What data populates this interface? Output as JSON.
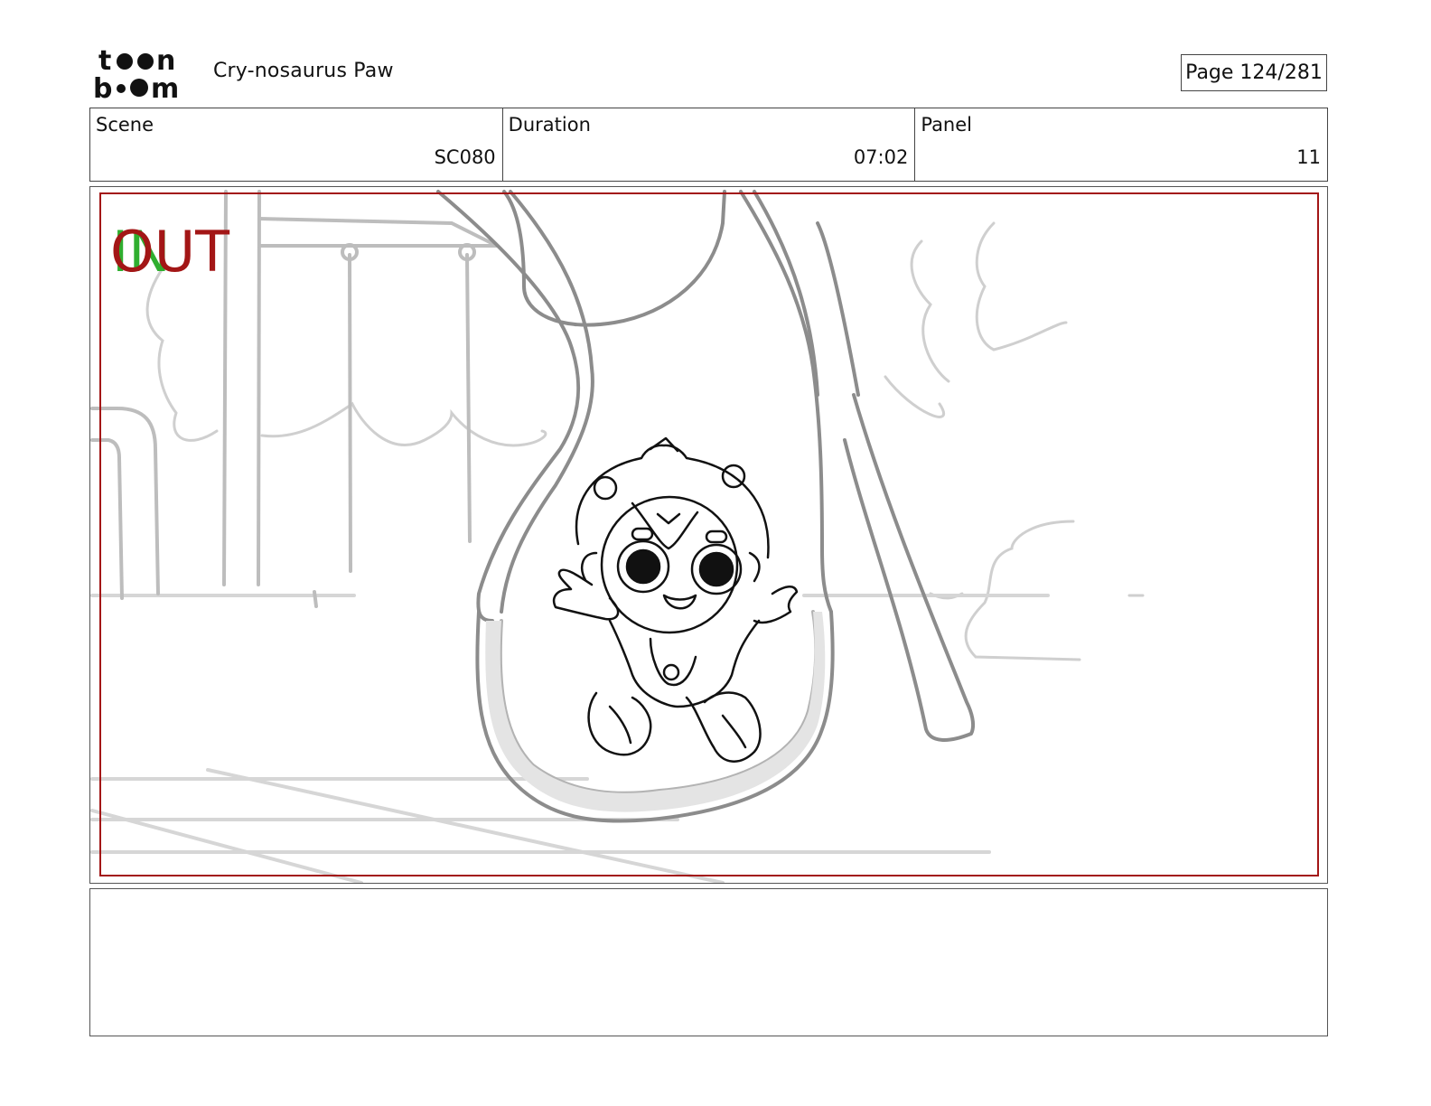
{
  "brand": {
    "logo_name": "toon boom logo"
  },
  "header": {
    "project_title": "Cry-nosaurus Paw",
    "page_label": "Page 124/281"
  },
  "info": {
    "scene_label": "Scene",
    "scene_value": "SC080",
    "duration_label": "Duration",
    "duration_value": "07:02",
    "panel_label": "Panel",
    "panel_value": "11"
  },
  "panel": {
    "in_marker": "IN",
    "out_marker": "OUT",
    "in_color": "#2fae2f",
    "out_color": "#a31616",
    "safe_frame_color": "#a31616"
  },
  "notes": {
    "text": ""
  }
}
